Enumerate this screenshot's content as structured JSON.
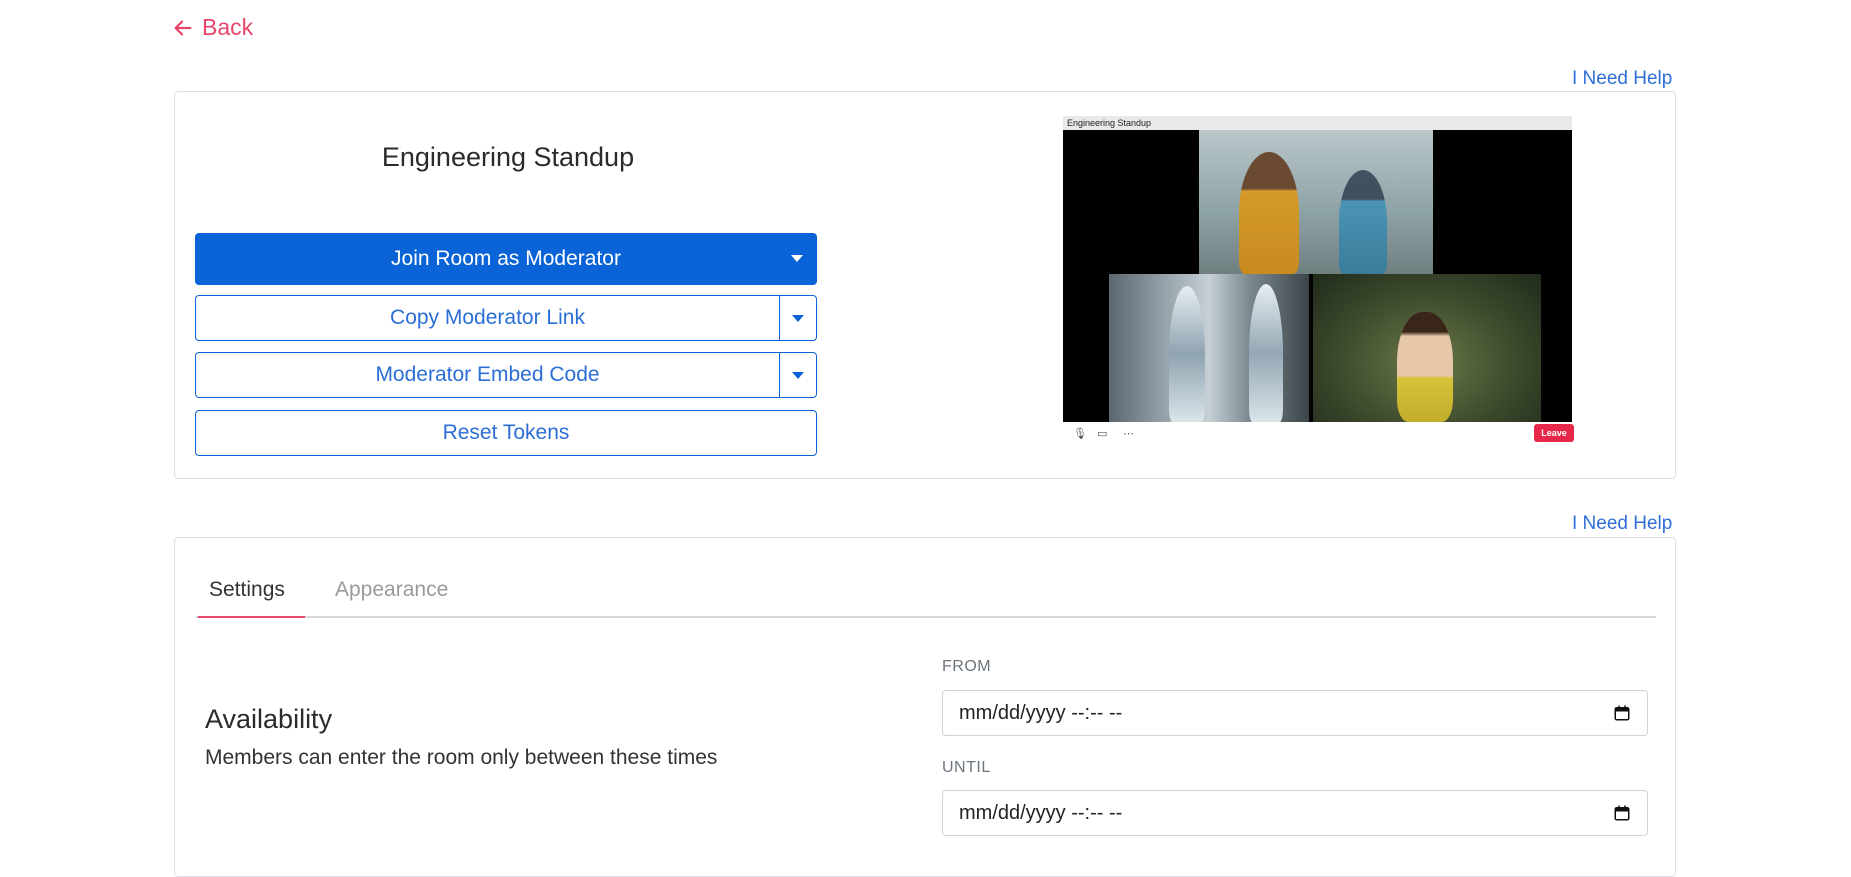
{
  "nav": {
    "back_label": "Back"
  },
  "help_label": "I Need Help",
  "room": {
    "title": "Engineering Standup",
    "join_label": "Join Room as Moderator",
    "copy_link_label": "Copy Moderator Link",
    "embed_label": "Moderator Embed Code",
    "reset_label": "Reset Tokens"
  },
  "preview": {
    "header_title": "Engineering Standup",
    "leave_label": "Leave",
    "icons": [
      "mic-off-icon",
      "camera-icon",
      "more-icon"
    ]
  },
  "tabs": [
    {
      "label": "Settings",
      "active": true
    },
    {
      "label": "Appearance",
      "active": false
    }
  ],
  "availability": {
    "title": "Availability",
    "description": "Members can enter the room only between these times",
    "from_label": "FROM",
    "from_value": "mm/dd/yyyy --:-- --",
    "until_label": "UNTIL",
    "until_value": "mm/dd/yyyy --:-- --"
  },
  "colors": {
    "primary": "#0b63d8",
    "accent": "#e8456b",
    "link": "#2f6fd6",
    "leave": "#e8284a"
  }
}
